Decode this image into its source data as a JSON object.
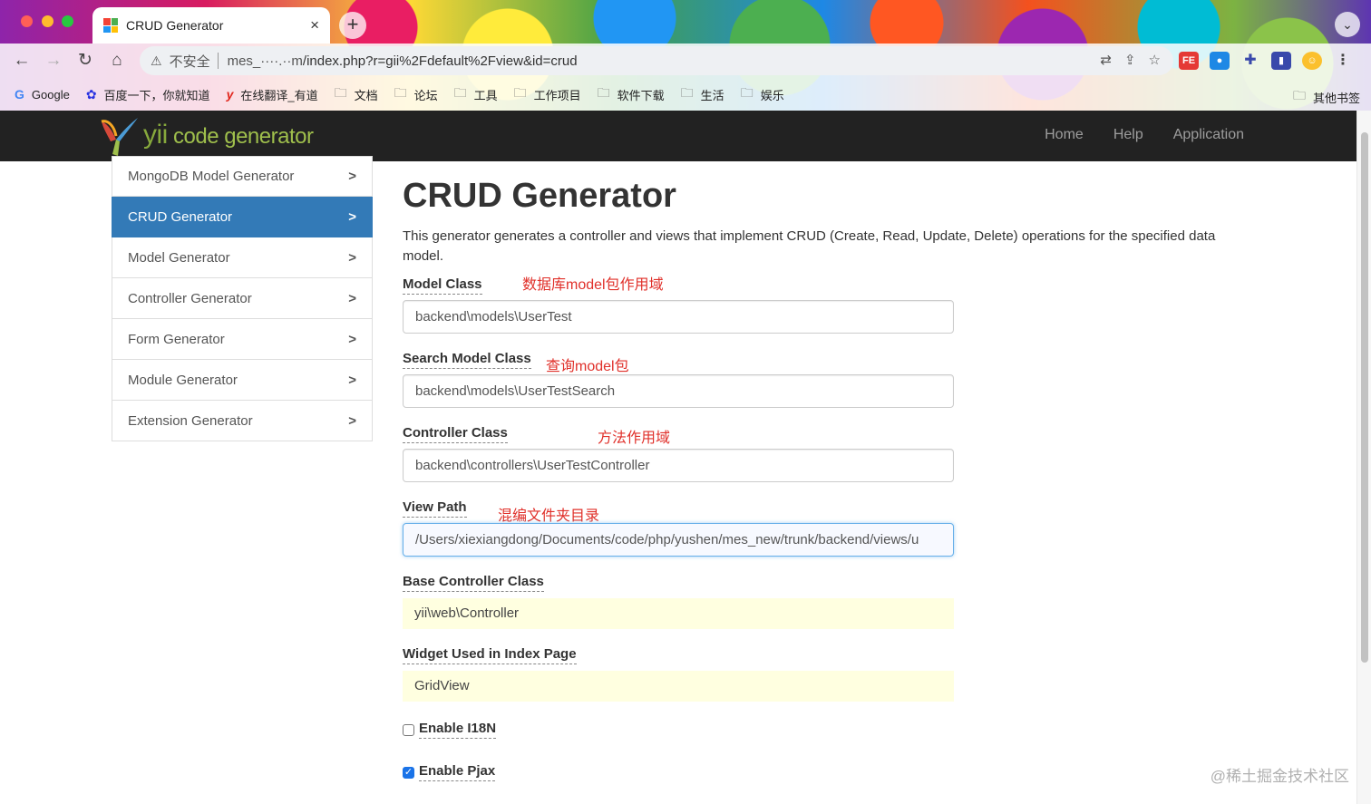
{
  "browser": {
    "tab_title": "CRUD Generator",
    "tab_close": "×",
    "new_tab": "+",
    "tab_menu": "⌄",
    "omnibox": {
      "security_label": "不安全",
      "host": "mes_····.··m",
      "path": "/index.php?r=gii%2Fdefault%2Fview&id=crud"
    },
    "bookmarks": [
      {
        "label": "Google",
        "icon": "google-icon"
      },
      {
        "label": "百度一下，你就知道",
        "icon": "baidu-icon"
      },
      {
        "label": "在线翻译_有道",
        "icon": "youdao-icon"
      },
      {
        "label": "文档",
        "icon": "folder-icon"
      },
      {
        "label": "论坛",
        "icon": "folder-icon"
      },
      {
        "label": "工具",
        "icon": "folder-icon"
      },
      {
        "label": "工作项目",
        "icon": "folder-icon"
      },
      {
        "label": "软件下载",
        "icon": "folder-icon"
      },
      {
        "label": "生活",
        "icon": "folder-icon"
      },
      {
        "label": "娱乐",
        "icon": "folder-icon"
      }
    ],
    "other_bookmarks": "其他书签"
  },
  "navbar": {
    "logo_text_yii": "yii",
    "logo_text_rest": "code generator",
    "links": [
      "Home",
      "Help",
      "Application"
    ]
  },
  "sidebar": {
    "items": [
      {
        "label": "MongoDB Model Generator",
        "active": false
      },
      {
        "label": "CRUD Generator",
        "active": true
      },
      {
        "label": "Model Generator",
        "active": false
      },
      {
        "label": "Controller Generator",
        "active": false
      },
      {
        "label": "Form Generator",
        "active": false
      },
      {
        "label": "Module Generator",
        "active": false
      },
      {
        "label": "Extension Generator",
        "active": false
      }
    ]
  },
  "main": {
    "title": "CRUD Generator",
    "description": "This generator generates a controller and views that implement CRUD (Create, Read, Update, Delete) operations for the specified data model.",
    "fields": {
      "model_class": {
        "label": "Model Class",
        "value": "backend\\models\\UserTest",
        "annotation": "数据库model包作用域"
      },
      "search_model_class": {
        "label": "Search Model Class",
        "value": "backend\\models\\UserTestSearch",
        "annotation": "查询model包"
      },
      "controller_class": {
        "label": "Controller Class",
        "value": "backend\\controllers\\UserTestController",
        "annotation": "方法作用域"
      },
      "view_path": {
        "label": "View Path",
        "value": "/Users/xiexiangdong/Documents/code/php/yushen/mes_new/trunk/backend/views/u",
        "annotation": "混编文件夹目录"
      },
      "base_controller_class": {
        "label": "Base Controller Class",
        "value": "yii\\web\\Controller"
      },
      "widget_used": {
        "label": "Widget Used in Index Page",
        "value": "GridView"
      }
    },
    "checkboxes": {
      "enable_i18n": {
        "label": "Enable I18N",
        "checked": false
      },
      "enable_pjax": {
        "label": "Enable Pjax",
        "checked": true
      }
    }
  },
  "watermark": "@稀土掘金技术社区",
  "colors": {
    "navbar_bg": "#222222",
    "active_item_bg": "#337ab7",
    "annotation_red": "#e0302a",
    "sticky_bg": "#ffffe0"
  }
}
